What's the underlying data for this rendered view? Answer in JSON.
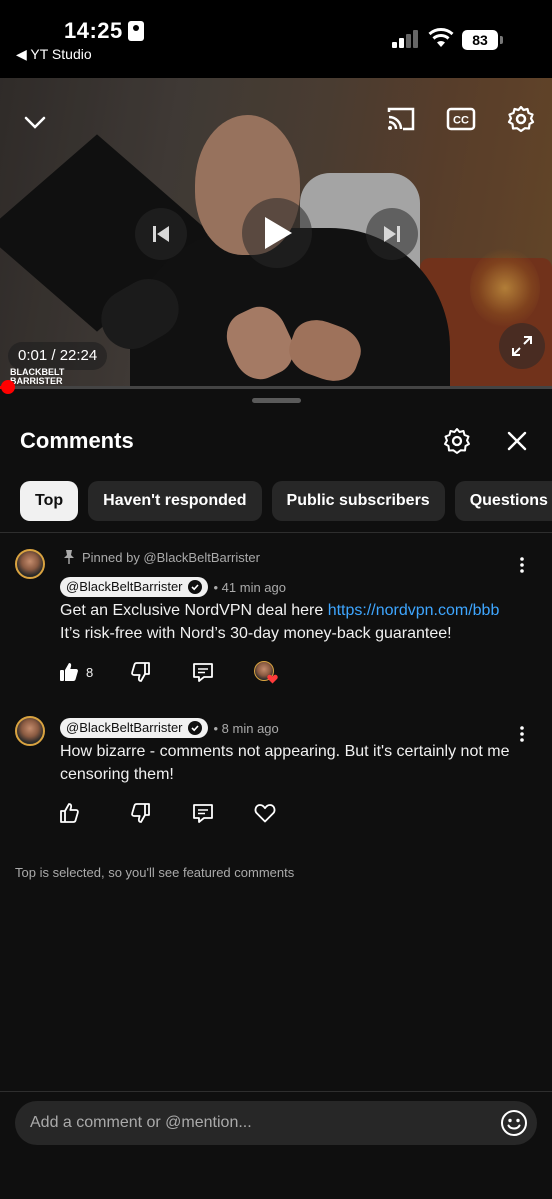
{
  "status_bar": {
    "time": "14:25",
    "back_app": "◀ YT Studio",
    "battery": "83"
  },
  "video": {
    "time_display": "0:01 / 22:24",
    "watermark_line1": "BLACKBELT",
    "watermark_line2": "BARRISTER",
    "progress_fraction": 0.0008
  },
  "panel": {
    "title": "Comments"
  },
  "chips": [
    {
      "label": "Top",
      "active": true
    },
    {
      "label": "Haven't responded",
      "active": false
    },
    {
      "label": "Public subscribers",
      "active": false
    },
    {
      "label": "Questions",
      "active": false
    }
  ],
  "comments": [
    {
      "pinned_label": "Pinned by @BlackBeltBarrister",
      "author": "@BlackBeltBarrister",
      "time": "• 41 min ago",
      "text_before_link": "Get an Exclusive NordVPN deal here ",
      "link": "https://nordvpn.com/bbb",
      "text_line2": "It’s risk-free with Nord’s 30-day money-back guarantee!",
      "like_count": "8"
    },
    {
      "author": "@BlackBeltBarrister",
      "time": "• 8 min ago",
      "text": "How bizarre - comments not appearing. But it's certainly not me censoring them!"
    }
  ],
  "footer_note": "Top is selected, so you'll see featured comments",
  "input": {
    "placeholder": "Add a comment or @mention..."
  },
  "colors": {
    "background": "#0f0f0f",
    "link": "#3ea6ff",
    "progress": "#ff0000",
    "avatar_ring": "#d9a340"
  }
}
